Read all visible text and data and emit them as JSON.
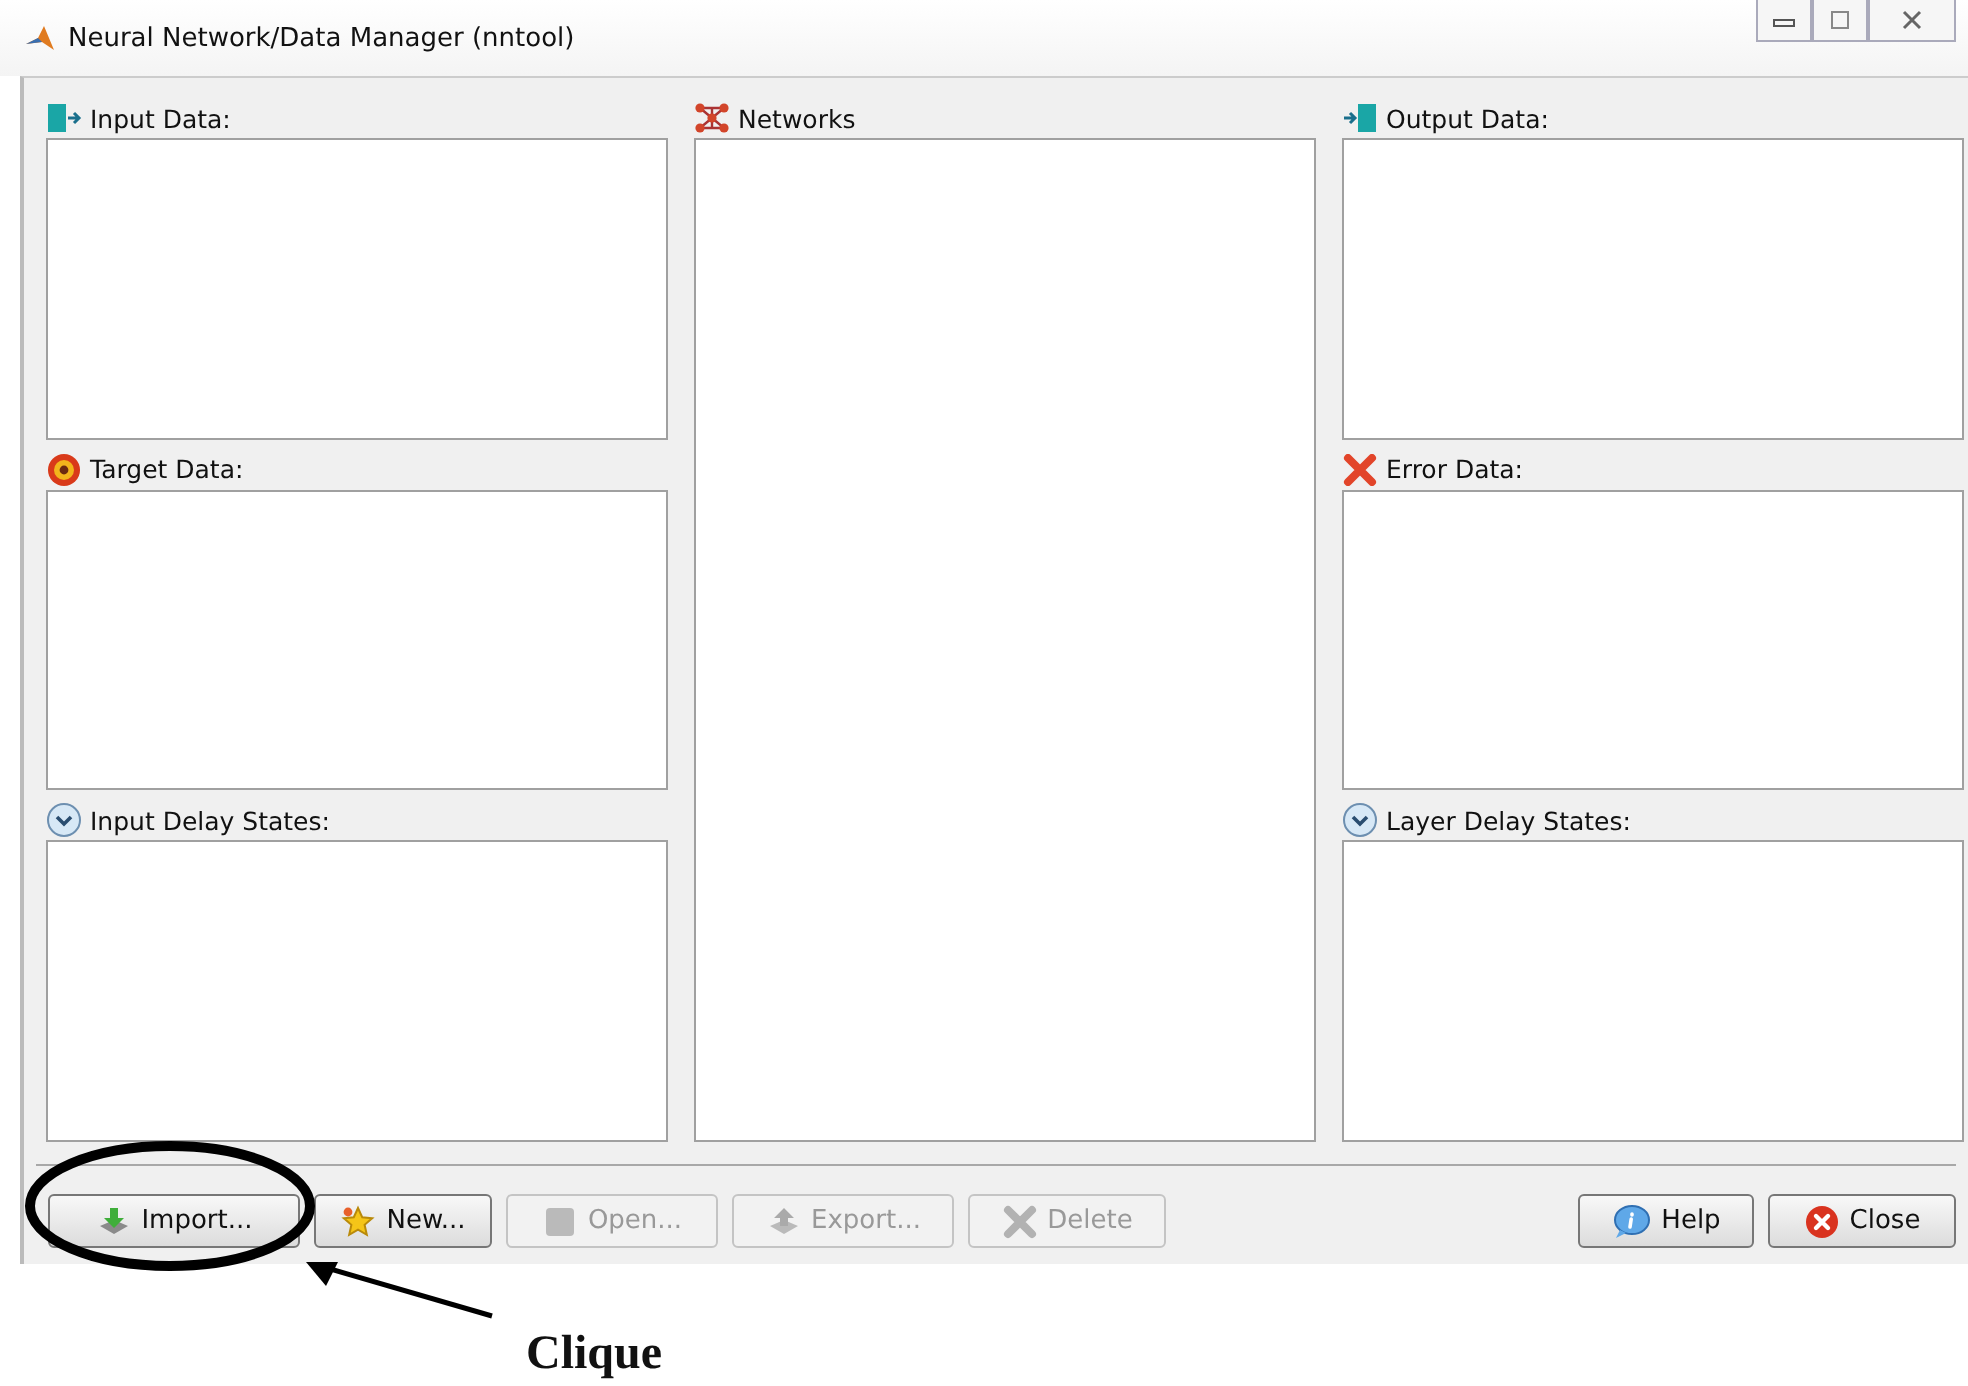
{
  "window": {
    "title": "Neural Network/Data Manager (nntool)"
  },
  "columns": [
    [
      {
        "label": "Input Data:",
        "kind": "input"
      },
      {
        "label": "Target Data:",
        "kind": "target"
      },
      {
        "label": "Input Delay States:",
        "kind": "delay"
      }
    ],
    [
      {
        "label": "Networks",
        "kind": "network"
      }
    ],
    [
      {
        "label": "Output Data:",
        "kind": "output"
      },
      {
        "label": "Error Data:",
        "kind": "error"
      },
      {
        "label": "Layer Delay States:",
        "kind": "delay"
      }
    ]
  ],
  "buttons_left": [
    {
      "label": "Import...",
      "kind": "import",
      "disabled": false
    },
    {
      "label": "New...",
      "kind": "new",
      "disabled": false
    },
    {
      "label": "Open...",
      "kind": "open",
      "disabled": true
    },
    {
      "label": "Export...",
      "kind": "export",
      "disabled": true
    },
    {
      "label": "Delete",
      "kind": "delete",
      "disabled": true
    }
  ],
  "buttons_right": [
    {
      "label": "Help",
      "kind": "help",
      "disabled": false
    },
    {
      "label": "Close",
      "kind": "close",
      "disabled": false
    }
  ],
  "annotation": {
    "label": "Clique"
  }
}
